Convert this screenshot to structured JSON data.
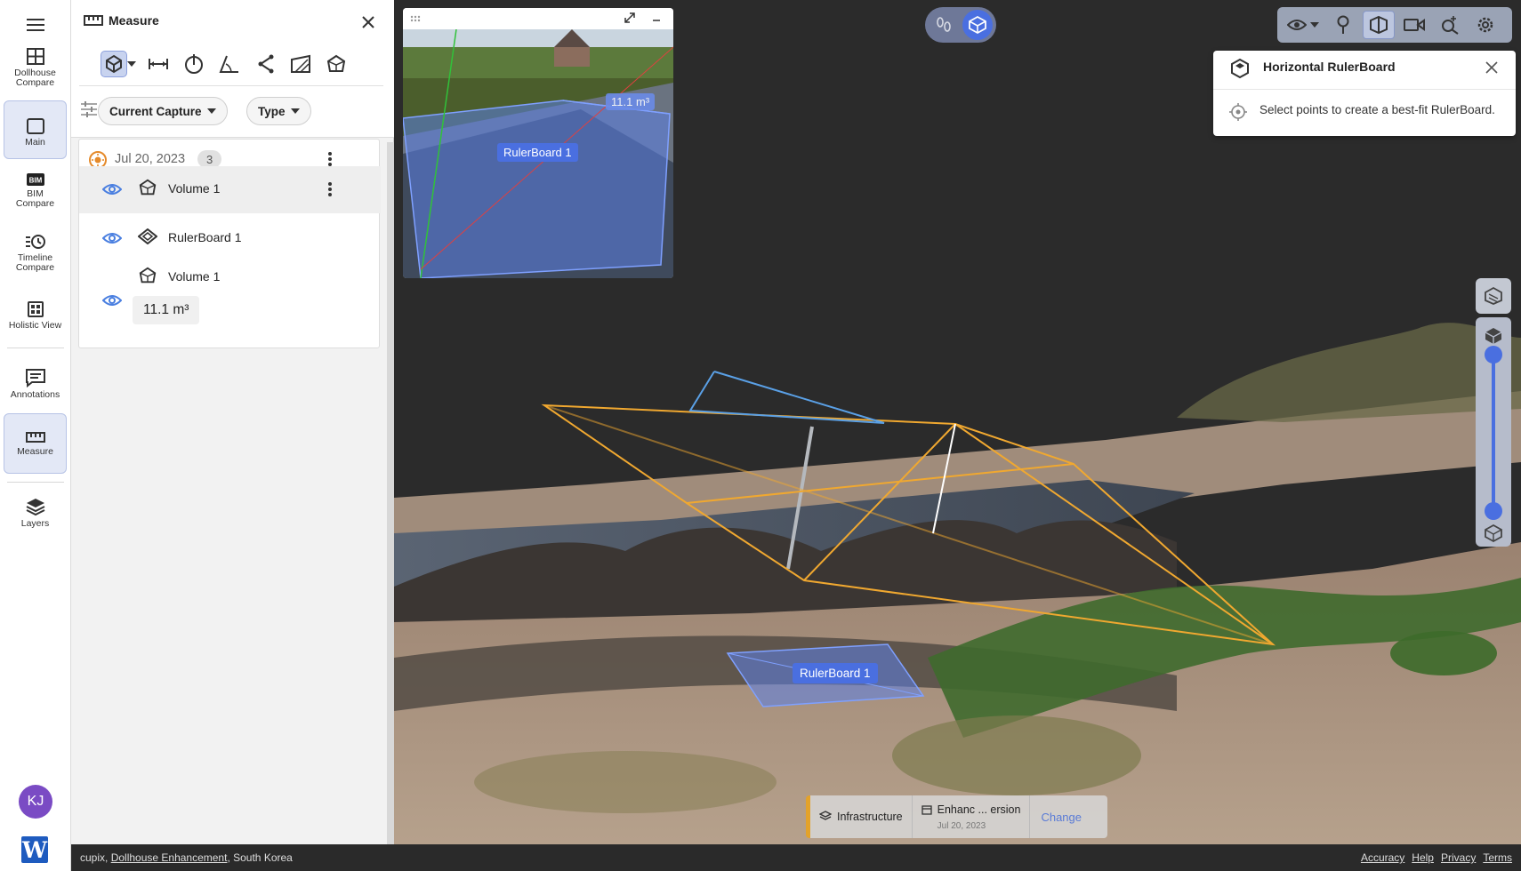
{
  "rail": {
    "items": [
      {
        "label": "Dollhouse\nCompare",
        "icon": "grid-icon"
      },
      {
        "label": "Main",
        "icon": "square-icon"
      },
      {
        "label": "BIM\nCompare",
        "icon": "bim-icon"
      },
      {
        "label": "Timeline\nCompare",
        "icon": "clock-list-icon"
      },
      {
        "label": "Holistic View",
        "icon": "grid-dots-icon"
      },
      {
        "label": "Annotations",
        "icon": "annotation-icon"
      },
      {
        "label": "Measure",
        "icon": "ruler-icon"
      },
      {
        "label": "Layers",
        "icon": "layers-icon"
      }
    ],
    "avatar_initials": "KJ",
    "app_logo": "W"
  },
  "panel": {
    "title": "Measure",
    "filters": {
      "capture": "Current Capture",
      "type": "Type"
    },
    "group": {
      "date": "Jul 20, 2023",
      "count": "3"
    },
    "items": [
      {
        "name": "Volume 1",
        "icon": "volume-icon"
      },
      {
        "name": "RulerBoard 1",
        "icon": "rulerboard-icon"
      },
      {
        "name": "Volume 1",
        "icon": "volume-icon",
        "value": "11.1 m³"
      }
    ]
  },
  "viewport": {
    "minimap": {
      "volume_label": "11.1 m³",
      "rulerboard_label": "RulerBoard 1"
    },
    "scene_label": "RulerBoard 1",
    "info_card": {
      "title": "Horizontal RulerBoard",
      "message": "Select points to create a best-fit RulerBoard."
    },
    "bottom_card": {
      "category": "Infrastructure",
      "version": "Enhanc ... ersion",
      "date": "Jul 20, 2023",
      "action": "Change"
    },
    "colors": {
      "accent": "#4a6fe0",
      "volume_outline": "#f0a830",
      "rulerboard_fill": "#5b7fe6"
    }
  },
  "footer": {
    "prefix": "cupix, ",
    "link": "Dollhouse Enhancement",
    "suffix": ", South Korea",
    "links": [
      "Accuracy",
      "Help",
      "Privacy",
      "Terms"
    ]
  }
}
